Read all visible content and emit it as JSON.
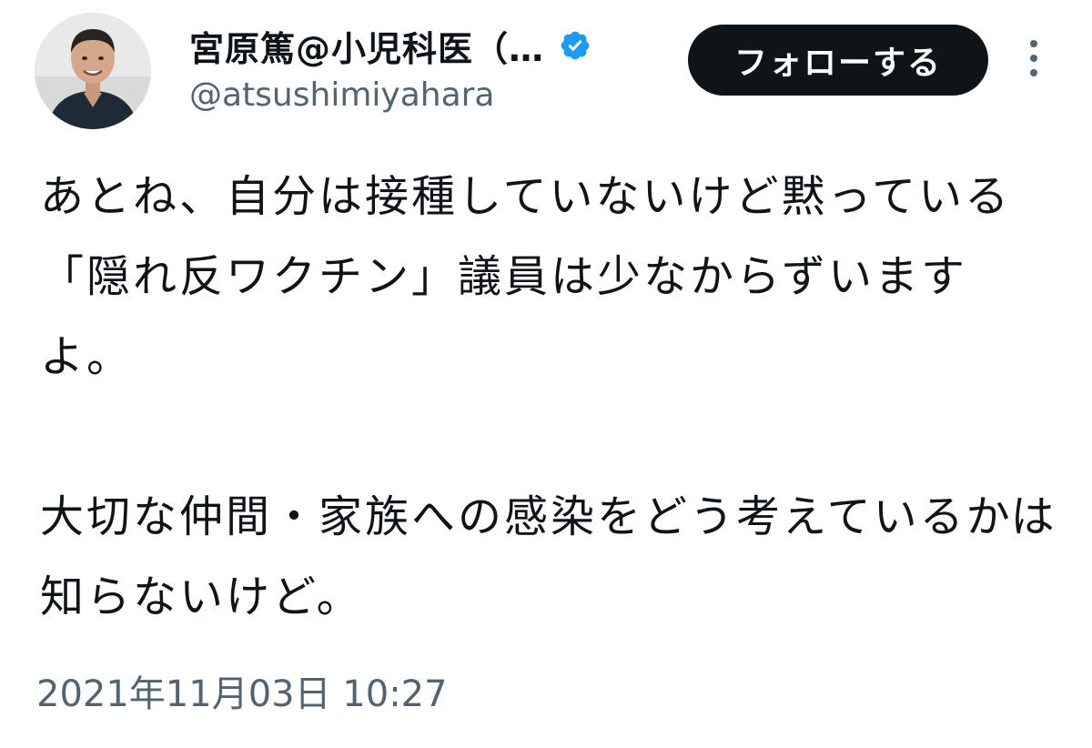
{
  "author": {
    "display_name": "宮原篤@小児科医（…",
    "handle": "@atsushimiyahara",
    "verified": true,
    "verified_color": "#1d9bf0"
  },
  "actions": {
    "follow_label": "フォローする",
    "more_icon": "more-vertical-icon"
  },
  "tweet": {
    "paragraph1": "あとね、自分は接種していないけど黙っている「隠れ反ワクチン」議員は少なからずいますよ。",
    "paragraph2": "大切な仲間・家族への感染をどう考えているかは知らないけど。",
    "timestamp": "2021年11月03日 10:27"
  },
  "colors": {
    "text_primary": "#0f1419",
    "text_secondary": "#536471",
    "follow_bg": "#0f1419",
    "follow_text": "#ffffff"
  }
}
